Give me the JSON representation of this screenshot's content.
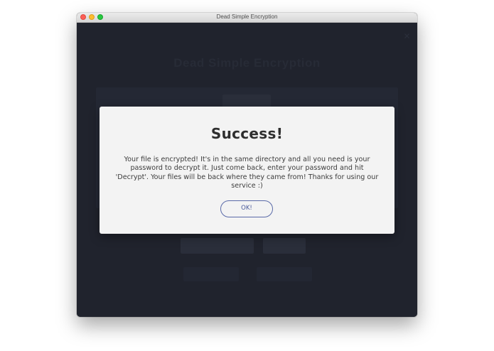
{
  "window": {
    "title": "Dead Simple Encryption"
  },
  "background": {
    "heading": "Dead Simple Encryption",
    "close_icon": "close-icon"
  },
  "dialog": {
    "title": "Success!",
    "message": "Your file is encrypted! It's in the same directory and all you need is your password to decrypt it. Just come back, enter your password and hit 'Decrypt'. Your files will be back where they came from! Thanks for using our service :)",
    "ok_label": "OK!"
  },
  "colors": {
    "background_dark": "#20232d",
    "modal_bg": "#f3f3f3",
    "ok_border": "#5a6aa8"
  }
}
